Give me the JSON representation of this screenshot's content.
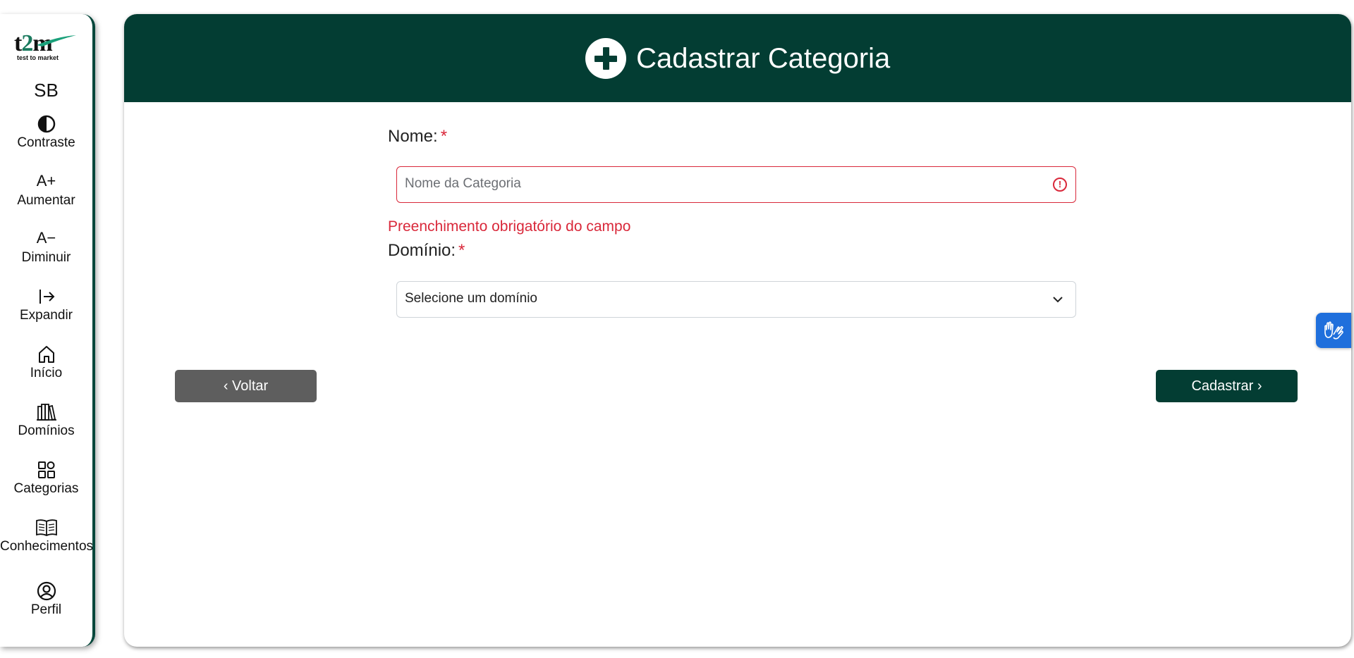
{
  "sidebar": {
    "logo": {
      "main_prefix": "t",
      "main_highlight": "2",
      "main_suffix": "m",
      "subtitle": "test to market"
    },
    "user_initials": "SB",
    "items": [
      {
        "label": "Contraste",
        "icon": "contrast-icon"
      },
      {
        "label": "Aumentar",
        "icon": "font-increase-icon",
        "glyph": "A+"
      },
      {
        "label": "Diminuir",
        "icon": "font-decrease-icon",
        "glyph": "A−"
      },
      {
        "label": "Expandir",
        "icon": "expand-icon"
      },
      {
        "label": "Início",
        "icon": "home-icon"
      },
      {
        "label": "Domínios",
        "icon": "library-icon"
      },
      {
        "label": "Categorias",
        "icon": "grid-icon"
      },
      {
        "label": "Conhecimentos",
        "icon": "book-icon"
      },
      {
        "label": "Perfil",
        "icon": "user-circle-icon"
      }
    ]
  },
  "header": {
    "title": "Cadastrar Categoria",
    "icon": "plus-circle-icon"
  },
  "form": {
    "name_label": "Nome:",
    "required_mark": "*",
    "name_placeholder": "Nome da Categoria",
    "name_value": "",
    "name_error": "Preenchimento obrigatório do campo",
    "domain_label": "Domínio:",
    "domain_selected": "Selecione um domínio"
  },
  "buttons": {
    "back": "‹ Voltar",
    "submit": "Cadastrar ›"
  },
  "colors": {
    "brand": "#033d33",
    "error": "#d9283a",
    "back_button": "#5e5e5e",
    "vlibras": "#1f6fdc"
  }
}
